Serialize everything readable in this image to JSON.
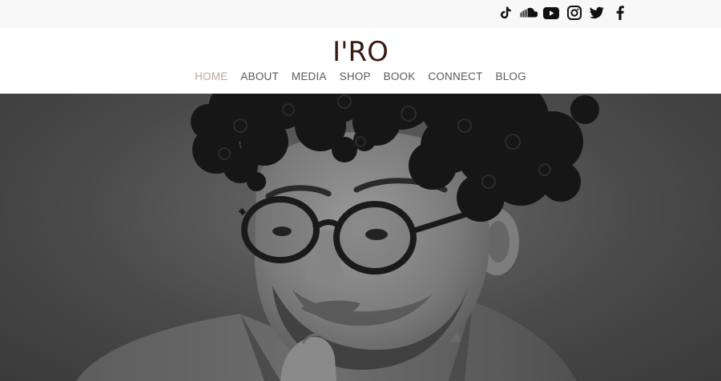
{
  "social": {
    "icons": [
      "tiktok-icon",
      "soundcloud-icon",
      "youtube-icon",
      "instagram-icon",
      "twitter-icon",
      "facebook-icon"
    ]
  },
  "header": {
    "logo": "I'RO"
  },
  "nav": {
    "items": [
      {
        "label": "HOME",
        "active": true
      },
      {
        "label": "ABOUT",
        "active": false
      },
      {
        "label": "MEDIA",
        "active": false
      },
      {
        "label": "SHOP",
        "active": false
      },
      {
        "label": "BOOK",
        "active": false
      },
      {
        "label": "CONNECT",
        "active": false
      },
      {
        "label": "BLOG",
        "active": false
      }
    ]
  },
  "hero": {
    "image": "black-and-white-portrait-man-curly-hair-glasses"
  },
  "colors": {
    "logo": "#3b1a12",
    "nav_active": "#c4a793",
    "nav_text": "#5a5a5a",
    "topbar_bg": "#f8f8f8"
  }
}
